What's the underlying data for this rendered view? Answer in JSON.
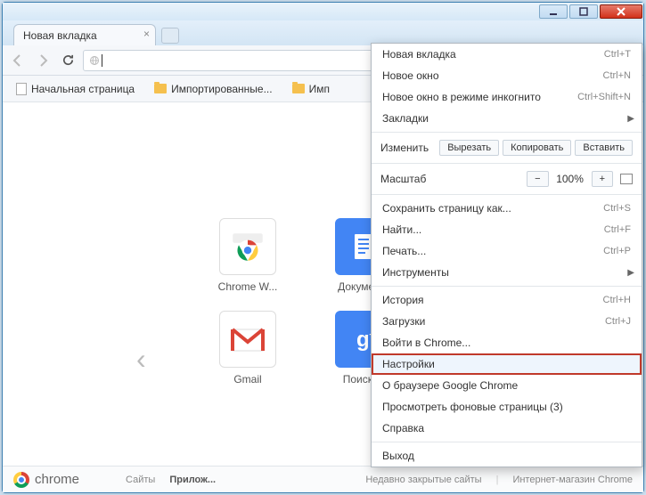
{
  "tab": {
    "title": "Новая вкладка"
  },
  "bookmarks": [
    {
      "type": "page",
      "label": "Начальная страница"
    },
    {
      "type": "folder",
      "label": "Импортированные..."
    },
    {
      "type": "folder",
      "label": "Имп"
    }
  ],
  "tiles": [
    {
      "label": "Chrome W...",
      "kind": "chrome"
    },
    {
      "label": "Докумен...",
      "kind": "docs"
    },
    {
      "label": "Gmail",
      "kind": "gmail"
    },
    {
      "label": "Поиск ...",
      "kind": "search"
    }
  ],
  "footer": {
    "brand": "chrome",
    "links": {
      "sites": "Сайты",
      "apps": "Прилож..."
    },
    "closed": "Недавно закрытые сайты",
    "store": "Интернет-магазин Chrome"
  },
  "menu": {
    "new_tab": {
      "label": "Новая вкладка",
      "sc": "Ctrl+T"
    },
    "new_window": {
      "label": "Новое окно",
      "sc": "Ctrl+N"
    },
    "incognito": {
      "label": "Новое окно в режиме инкогнито",
      "sc": "Ctrl+Shift+N"
    },
    "bookmarks": {
      "label": "Закладки"
    },
    "edit": {
      "label": "Изменить",
      "cut": "Вырезать",
      "copy": "Копировать",
      "paste": "Вставить"
    },
    "zoom": {
      "label": "Масштаб",
      "minus": "−",
      "value": "100%",
      "plus": "+"
    },
    "save": {
      "label": "Сохранить страницу как...",
      "sc": "Ctrl+S"
    },
    "find": {
      "label": "Найти...",
      "sc": "Ctrl+F"
    },
    "print": {
      "label": "Печать...",
      "sc": "Ctrl+P"
    },
    "tools": {
      "label": "Инструменты"
    },
    "history": {
      "label": "История",
      "sc": "Ctrl+H"
    },
    "downloads": {
      "label": "Загрузки",
      "sc": "Ctrl+J"
    },
    "signin": {
      "label": "Войти в Chrome..."
    },
    "settings": {
      "label": "Настройки"
    },
    "about": {
      "label": "О браузере Google Chrome"
    },
    "bgpages": {
      "label": "Просмотреть фоновые страницы (3)"
    },
    "help": {
      "label": "Справка"
    },
    "exit": {
      "label": "Выход"
    }
  }
}
